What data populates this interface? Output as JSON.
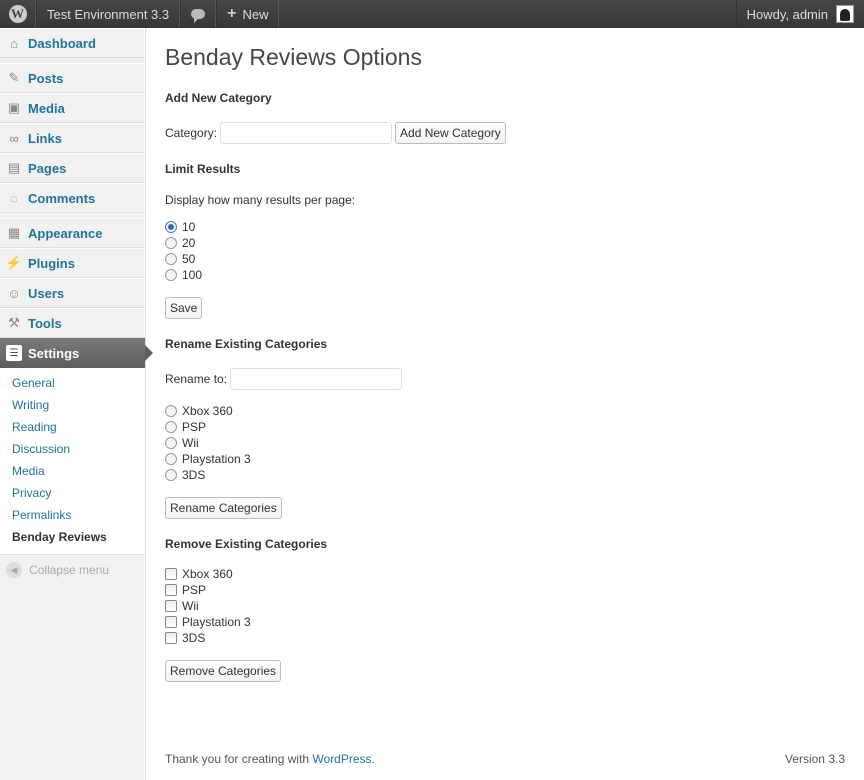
{
  "admin_bar": {
    "site_name": "Test Environment 3.3",
    "new_label": "New",
    "greeting": "Howdy, admin"
  },
  "sidebar": {
    "items": [
      {
        "label": "Dashboard",
        "icon": "dashboard-icon"
      },
      {
        "label": "Posts",
        "icon": "pin-icon"
      },
      {
        "label": "Media",
        "icon": "media-icon"
      },
      {
        "label": "Links",
        "icon": "link-icon"
      },
      {
        "label": "Pages",
        "icon": "pages-icon"
      },
      {
        "label": "Comments",
        "icon": "comment-icon"
      },
      {
        "label": "Appearance",
        "icon": "appearance-icon"
      },
      {
        "label": "Plugins",
        "icon": "plug-icon"
      },
      {
        "label": "Users",
        "icon": "users-icon"
      },
      {
        "label": "Tools",
        "icon": "tools-icon"
      },
      {
        "label": "Settings",
        "icon": "settings-icon"
      }
    ],
    "settings_submenu": [
      "General",
      "Writing",
      "Reading",
      "Discussion",
      "Media",
      "Privacy",
      "Permalinks",
      "Benday Reviews"
    ],
    "collapse_label": "Collapse menu"
  },
  "page": {
    "title": "Benday Reviews Options",
    "add_section": {
      "heading": "Add New Category",
      "field_label": "Category:",
      "value": "",
      "button": "Add New Category"
    },
    "limit_section": {
      "heading": "Limit Results",
      "prompt": "Display how many results per page:",
      "options": [
        "10",
        "20",
        "50",
        "100"
      ],
      "selected": "10",
      "button": "Save"
    },
    "rename_section": {
      "heading": "Rename Existing Categories",
      "field_label": "Rename to:",
      "value": "",
      "categories": [
        "Xbox 360",
        "PSP",
        "Wii",
        "Playstation 3",
        "3DS"
      ],
      "button": "Rename Categories"
    },
    "remove_section": {
      "heading": "Remove Existing Categories",
      "categories": [
        "Xbox 360",
        "PSP",
        "Wii",
        "Playstation 3",
        "3DS"
      ],
      "button": "Remove Categories"
    }
  },
  "footer": {
    "thanks": "Thank you for creating with ",
    "link": "WordPress",
    "period": ".",
    "version": "Version 3.3"
  }
}
